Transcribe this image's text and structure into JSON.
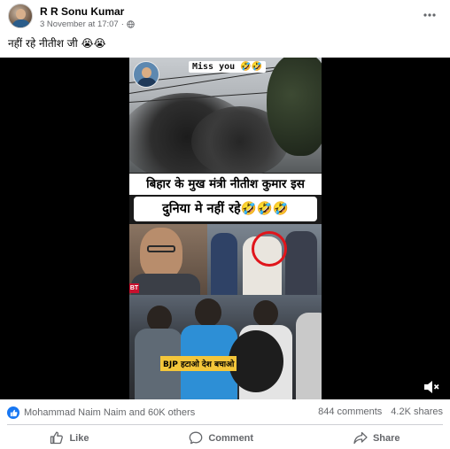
{
  "post": {
    "author": "R R Sonu Kumar",
    "timestamp": "3 November at 17:07",
    "caption": "नहीं रहे नीतीश जी 😭😭"
  },
  "video": {
    "overlay_top": "Miss you 🤣🤣",
    "headline_line1": "बिहार के मुख मंत्री नीतीश  कुमार इस",
    "headline_line2": "दुनिया मे नहीं रहे🤣🤣🤣",
    "caption_badge": "BJP हटाओ देश बचाओ",
    "tv_logo": "BT"
  },
  "engagement": {
    "reactions_text": "Mohammad Naim Naim and 60K others",
    "comments": "844 comments",
    "shares": "4.2K shares"
  },
  "actions": {
    "like": "Like",
    "comment": "Comment",
    "share": "Share"
  },
  "colors": {
    "facebook_blue": "#1877f2",
    "secondary_text": "#65676b",
    "badge_yellow": "#f4c63a",
    "highlight_red": "#e0151b"
  },
  "icons": [
    "more-options-icon",
    "globe-icon",
    "mute-icon",
    "like-reaction-icon",
    "like-icon",
    "comment-icon",
    "share-icon"
  ]
}
